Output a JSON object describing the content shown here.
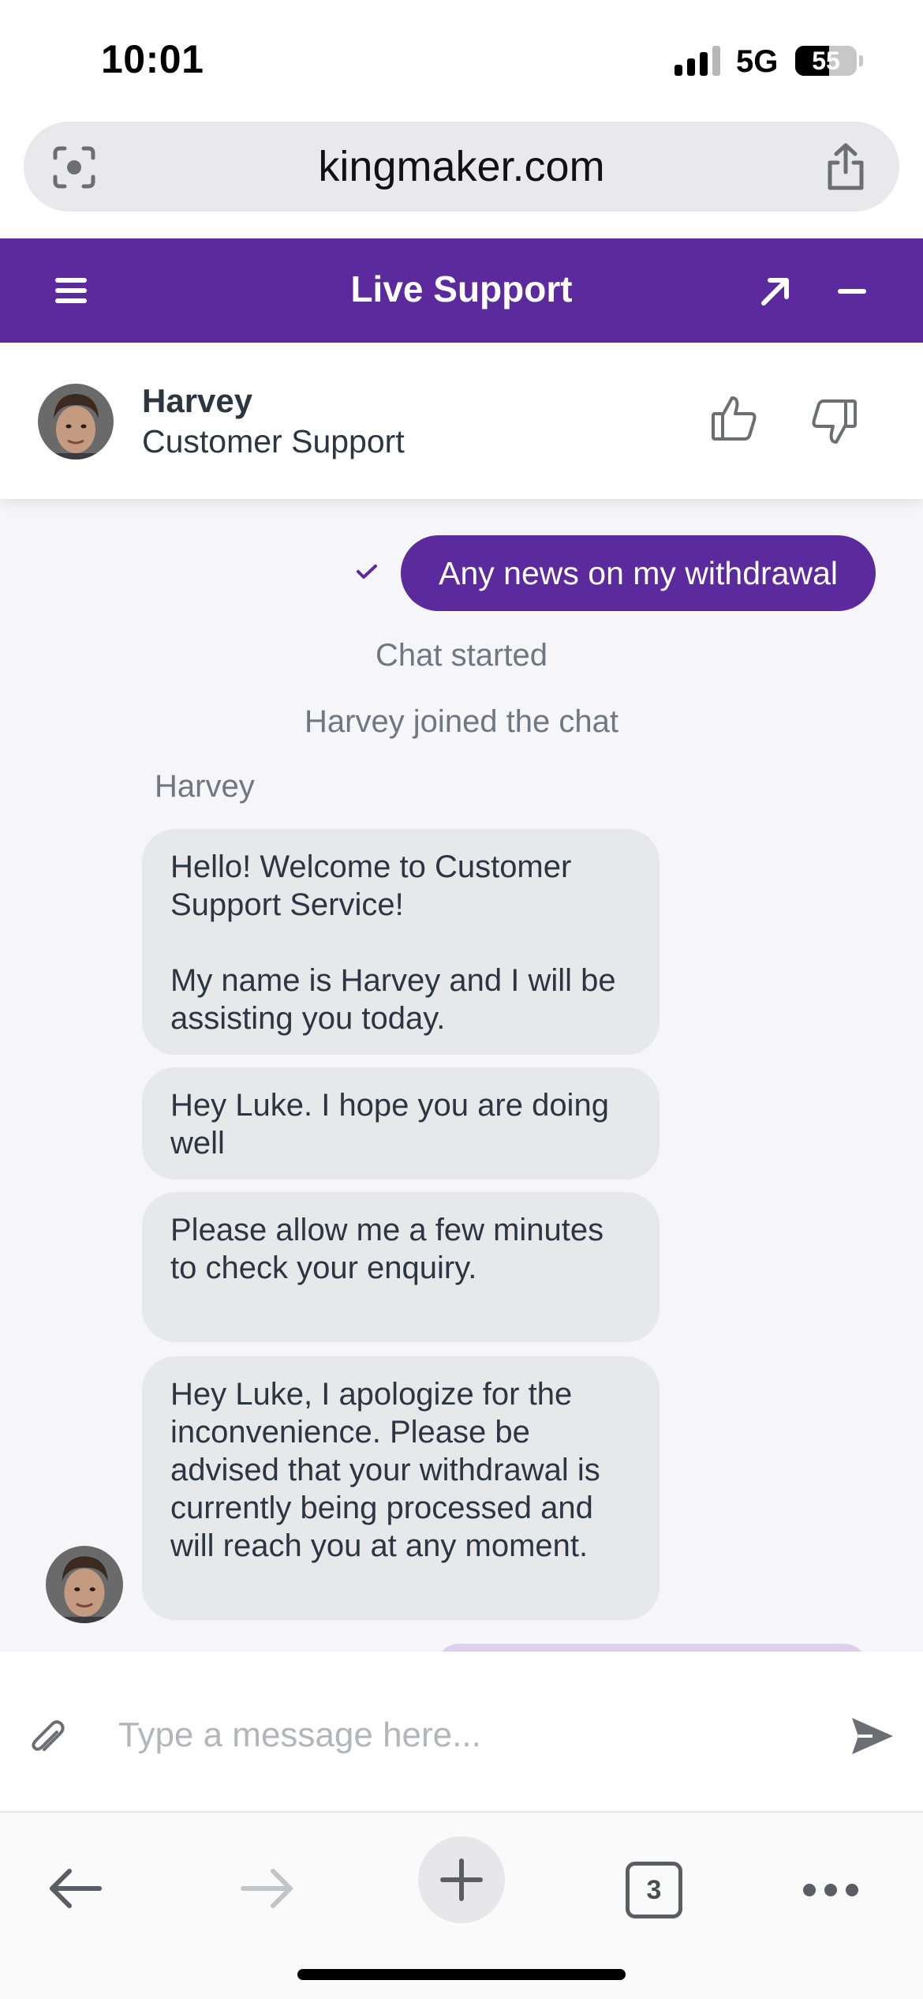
{
  "status_bar": {
    "time": "10:01",
    "network": "5G",
    "battery_level": "55",
    "battery_percent": 55
  },
  "browser": {
    "url": "kingmaker.com",
    "scan_icon": "camera-scan-icon",
    "share_icon": "share-icon",
    "toolbar": {
      "back_icon": "arrow-left-icon",
      "forward_icon": "arrow-right-icon",
      "new_tab_icon": "plus-icon",
      "tab_count": "3",
      "more_icon": "ellipsis-icon"
    }
  },
  "widget": {
    "title": "Live Support",
    "accent_color": "#5b2a9c",
    "menu_icon": "hamburger-icon",
    "popout_icon": "arrow-up-right-icon",
    "minimize_icon": "minus-icon"
  },
  "agent": {
    "name": "Harvey",
    "role": "Customer Support",
    "rate_up_icon": "thumbs-up-icon",
    "rate_down_icon": "thumbs-down-icon"
  },
  "chat": {
    "outgoing": {
      "text": "Any news on my withdrawal",
      "status_icon": "checkmark-icon"
    },
    "system_messages": [
      "Chat started",
      "Harvey joined the chat"
    ],
    "sender_label": "Harvey",
    "incoming": [
      {
        "text": "Hello! Welcome to Customer Support Service!\n\nMy name is Harvey and I will be assisting you today."
      },
      {
        "text": "Hey Luke. I hope you are doing well"
      },
      {
        "text": "Please allow me a few minutes to check your enquiry."
      },
      {
        "text": "Hey Luke, I apologize for the inconvenience. Please be advised that your withdrawal is currently being processed and will reach you at any moment."
      }
    ]
  },
  "composer": {
    "placeholder": "Type a message here...",
    "attach_icon": "paperclip-icon",
    "send_icon": "send-icon"
  }
}
